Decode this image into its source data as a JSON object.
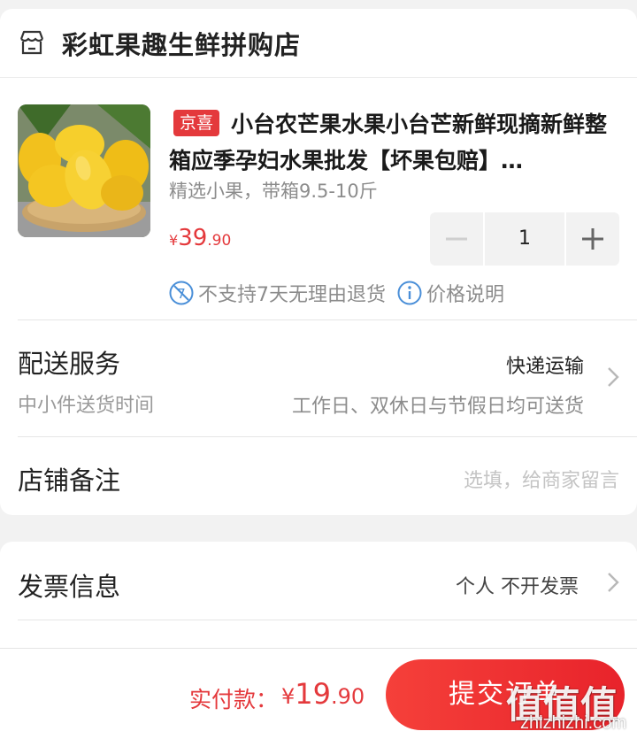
{
  "shop": {
    "name": "彩虹果趣生鲜拼购店",
    "icon": "store-icon"
  },
  "product": {
    "tag": "京喜",
    "title": "小台农芒果水果小台芒新鲜现摘新鲜整箱应季孕妇水果批发【坏果包赔】…",
    "spec": "精选小果，带箱9.5-10斤",
    "price_currency": "¥",
    "price_int": "39",
    "price_dec": ".90",
    "quantity": "1",
    "image": "mango-photo"
  },
  "notices": {
    "no_return": "不支持7天无理由退货",
    "price_info": "价格说明"
  },
  "delivery": {
    "title": "配送服务",
    "subtitle": "中小件送货时间",
    "method": "快递运输",
    "schedule": "工作日、双休日与节假日均可送货"
  },
  "remark": {
    "title": "店铺备注",
    "placeholder": "选填，给商家留言"
  },
  "invoice": {
    "title": "发票信息",
    "value": "个人 不开发票"
  },
  "bottom": {
    "pay_label": "实付款：",
    "pay_currency": "¥",
    "pay_int": "19",
    "pay_dec": ".90",
    "submit_label": "提交订单"
  },
  "watermark": {
    "glyphs": "值值值",
    "url": "zhizhizhi.com"
  },
  "colors": {
    "accent": "#e4393c",
    "background": "#f2f2f2",
    "muted_text": "#8c8c8c",
    "info_blue": "#4a8fd8"
  }
}
